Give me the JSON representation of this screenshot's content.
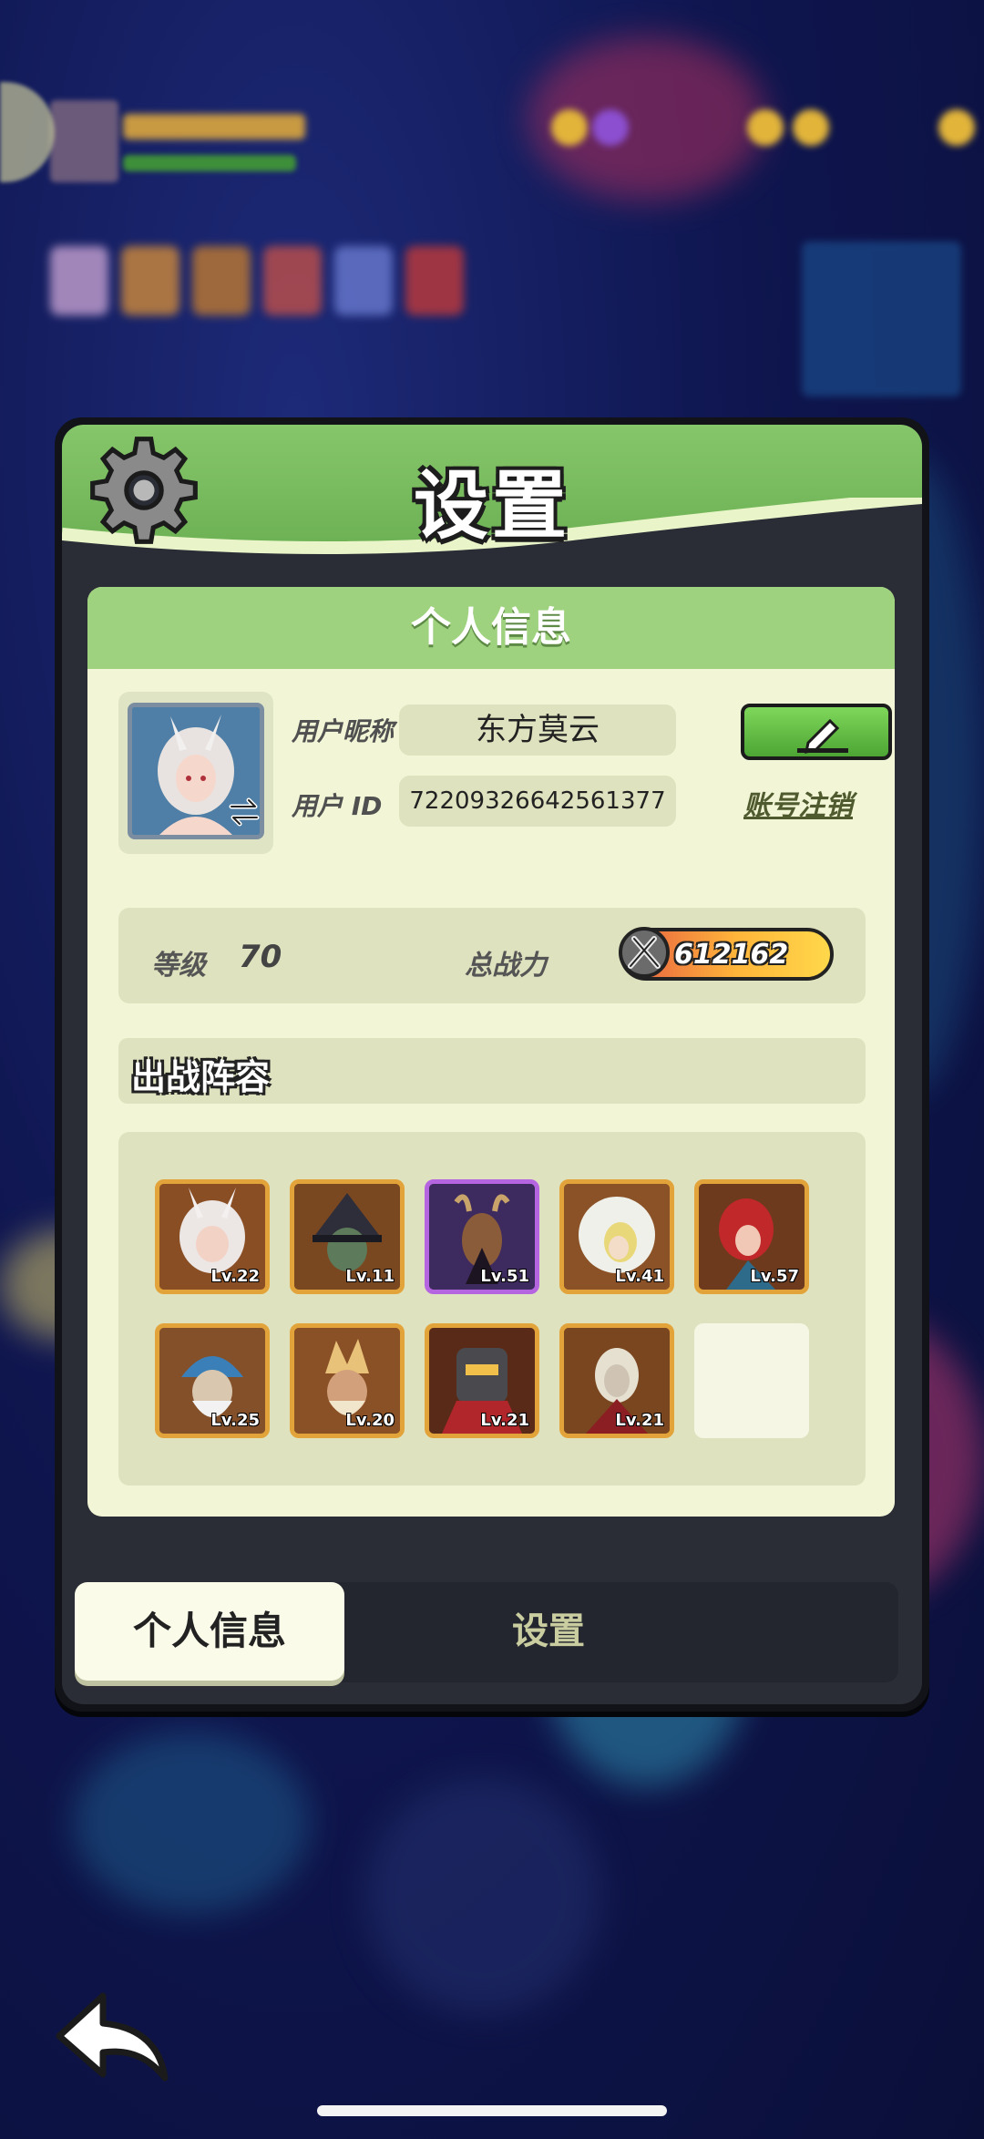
{
  "dialog": {
    "title": "设置"
  },
  "personal_info": {
    "section_title": "个人信息",
    "nickname_label": "用户昵称",
    "nickname_value": "东方莫云",
    "id_label": "用户 ID",
    "id_value": "72209326642561377",
    "account_cancel_label": "账号注销",
    "level_label": "等级",
    "level_value": "70",
    "power_label": "总战力",
    "power_value": "612162"
  },
  "lineup": {
    "title": "出战阵容",
    "heroes": [
      {
        "level": "Lv.22"
      },
      {
        "level": "Lv.11"
      },
      {
        "level": "Lv.51"
      },
      {
        "level": "Lv.41"
      },
      {
        "level": "Lv.57"
      },
      {
        "level": "Lv.25"
      },
      {
        "level": "Lv.20"
      },
      {
        "level": "Lv.21"
      },
      {
        "level": "Lv.21"
      }
    ]
  },
  "tabs": {
    "active": "个人信息",
    "inactive": "设置"
  },
  "colors": {
    "header_green": "#86c66a",
    "card_bg": "#f2f6d6",
    "hero_border_gold": "#e2a43a",
    "hero_border_purple": "#b665e0"
  }
}
